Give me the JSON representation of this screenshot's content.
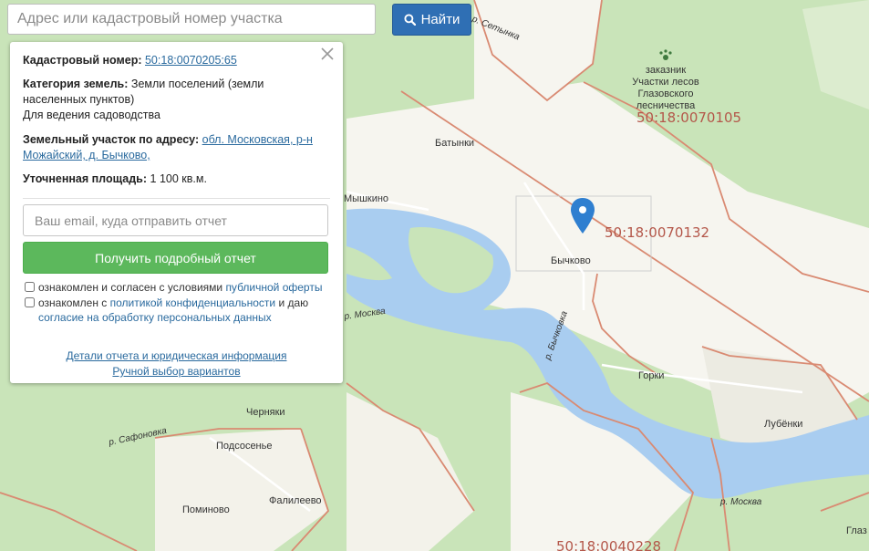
{
  "search": {
    "placeholder": "Адрес или кадастровый номер участка",
    "button_label": "Найти",
    "button_icon": "search-icon"
  },
  "panel": {
    "cadastral_label": "Кадастровый номер:",
    "cadastral_value": "50:18:0070205:65",
    "category_label": "Категория земель:",
    "category_value": "Земли поселений (земли населенных пунктов)",
    "usage": "Для ведения садоводства",
    "address_label": "Земельный участок по адресу:",
    "address_value": "обл. Московская, р-н Можайский, д. Бычково,",
    "area_label": "Уточненная площадь:",
    "area_value": "1 100 кв.м.",
    "email_placeholder": "Ваш email, куда отправить отчет",
    "report_button": "Получить подробный отчет",
    "consent1_text": "ознакомлен и согласен с условиями ",
    "consent1_link": "публичной оферты",
    "consent2_text": "ознакомлен с ",
    "consent2_link": "политикой конфиденциальности",
    "consent2_after": " и даю",
    "consent2_link2": "согласие на обработку персональных данных",
    "details_link": "Детали отчета и юридическая информация",
    "manual_link": "Ручной выбор вариантов",
    "close_icon": "close-icon"
  },
  "map": {
    "reserve_lines": [
      "заказник",
      "Участки лесов",
      "Глазовского",
      "лесничества"
    ],
    "cadastral_labels": [
      "50:18:0070105",
      "50:18:0070132",
      "50:18:0040228"
    ],
    "places": [
      "Батынки",
      "Мышкино",
      "Бычково",
      "Горки",
      "Лубёнки",
      "Черняки",
      "Подсосенье",
      "Поминово",
      "Фалилеево",
      "Глаз"
    ],
    "rivers": [
      "р. Москва",
      "р. Бычковка",
      "р. Сафоновка",
      "р. Москва",
      "р. Сетынка"
    ],
    "marker_icon": "map-pin-icon",
    "reserve_icon": "paw-icon",
    "colors": {
      "forest": "#c6e3b6",
      "field": "#f5f4ee",
      "water": "#a9cdf0",
      "boundary": "#d98a72",
      "marker": "#2f7fd0"
    }
  }
}
